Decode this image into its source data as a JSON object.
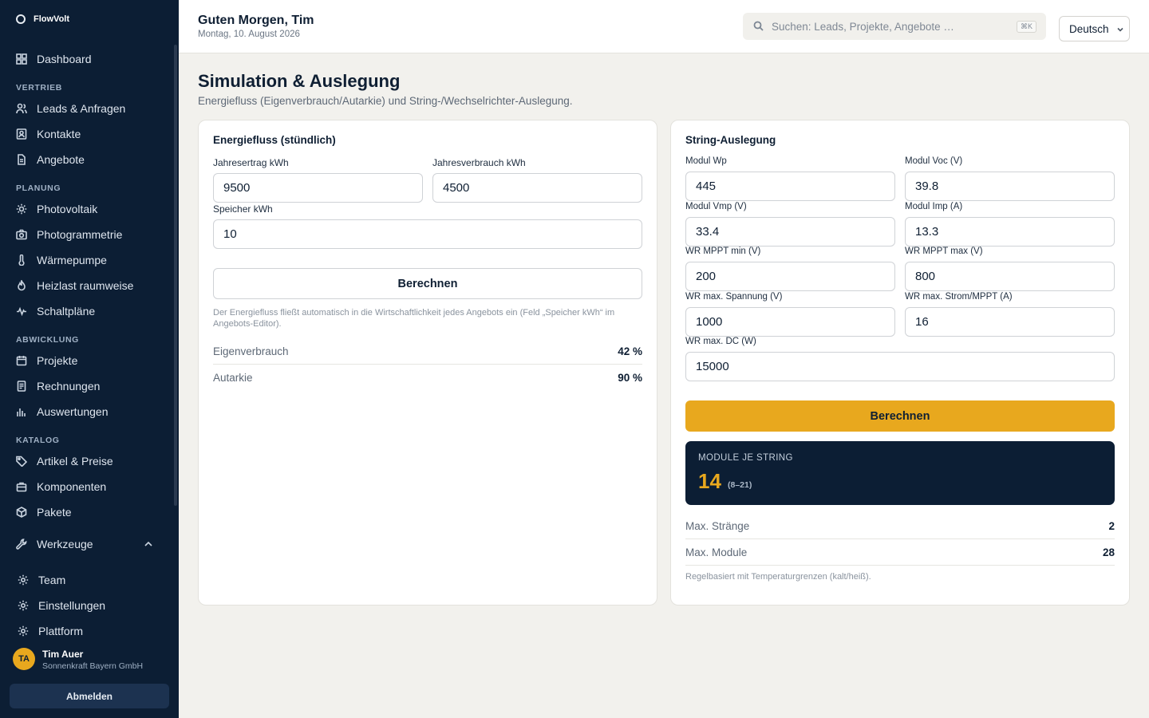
{
  "app": {
    "brand": "FlowVolt"
  },
  "sidebar": {
    "dashboard": "Dashboard",
    "sections": {
      "vertrieb": "VERTRIEB",
      "planung": "PLANUNG",
      "abwicklung": "ABWICKLUNG",
      "katalog": "KATALOG"
    },
    "items": {
      "leads": "Leads & Anfragen",
      "kontakte": "Kontakte",
      "angebote": "Angebote",
      "photovoltaik": "Photovoltaik",
      "photogrammetrie": "Photogrammetrie",
      "waermepumpe": "Wärmepumpe",
      "heizlast": "Heizlast raumweise",
      "schaltplaene": "Schaltpläne",
      "projekte": "Projekte",
      "rechnungen": "Rechnungen",
      "auswertungen": "Auswertungen",
      "artikel": "Artikel & Preise",
      "komponenten": "Komponenten",
      "pakete": "Pakete",
      "werkzeuge": "Werkzeuge",
      "team": "Team",
      "einstellungen": "Einstellungen",
      "plattform": "Plattform"
    },
    "user": {
      "initials": "TA",
      "name": "Tim Auer",
      "company": "Sonnenkraft Bayern GmbH"
    },
    "logout": "Abmelden"
  },
  "header": {
    "greeting": "Guten Morgen, Tim",
    "date": "Montag, 10. August 2026",
    "search_placeholder": "Suchen: Leads, Projekte, Angebote …",
    "search_shortcut": "⌘K",
    "language": "Deutsch"
  },
  "page": {
    "title": "Simulation & Auslegung",
    "subtitle": "Energiefluss (Eigenverbrauch/Autarkie) und String-/Wechselrichter-Auslegung."
  },
  "energy": {
    "title": "Energiefluss (stündlich)",
    "jahresertrag_label": "Jahresertrag kWh",
    "jahresertrag_value": "9500",
    "jahresverbrauch_label": "Jahresverbrauch kWh",
    "jahresverbrauch_value": "4500",
    "speicher_label": "Speicher kWh",
    "speicher_value": "10",
    "calc_button": "Berechnen",
    "note": "Der Energiefluss fließt automatisch in die Wirtschaftlichkeit jedes Angebots ein (Feld „Speicher kWh“ im Angebots-Editor).",
    "eigenverbrauch_label": "Eigenverbrauch",
    "eigenverbrauch_value": "42 %",
    "autarkie_label": "Autarkie",
    "autarkie_value": "90 %"
  },
  "string": {
    "title": "String-Auslegung",
    "fields": {
      "modul_wp": {
        "label": "Modul Wp",
        "value": "445"
      },
      "modul_voc": {
        "label": "Modul Voc (V)",
        "value": "39.8"
      },
      "modul_vmp": {
        "label": "Modul Vmp (V)",
        "value": "33.4"
      },
      "modul_imp": {
        "label": "Modul Imp (A)",
        "value": "13.3"
      },
      "wr_mppt_min": {
        "label": "WR MPPT min (V)",
        "value": "200"
      },
      "wr_mppt_max": {
        "label": "WR MPPT max (V)",
        "value": "800"
      },
      "wr_max_spannung": {
        "label": "WR max. Spannung (V)",
        "value": "1000"
      },
      "wr_max_strom": {
        "label": "WR max. Strom/MPPT (A)",
        "value": "16"
      },
      "wr_max_dc": {
        "label": "WR max. DC (W)",
        "value": "15000"
      }
    },
    "calc_button": "Berechnen",
    "result_label": "MODULE JE STRING",
    "result_value": "14",
    "result_range": "(8–21)",
    "max_straenge_label": "Max. Stränge",
    "max_straenge_value": "2",
    "max_module_label": "Max. Module",
    "max_module_value": "28",
    "note": "Regelbasiert mit Temperaturgrenzen (kalt/heiß)."
  },
  "colors": {
    "sidebar": "#0c1e34",
    "accent": "#e8a81e",
    "background": "#f2f1ed"
  }
}
